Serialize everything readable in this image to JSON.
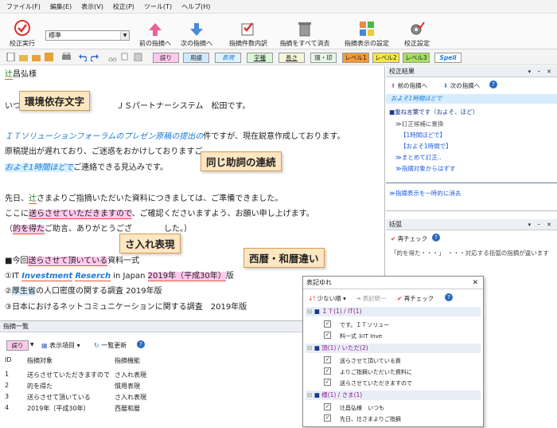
{
  "menu": [
    "ファイル(F)",
    "編集(E)",
    "表示(V)",
    "校正(P)",
    "ツール(T)",
    "ヘルプ(H)"
  ],
  "ribbon": {
    "run": "校正実行",
    "style_value": "標準",
    "prev": "前の指摘へ",
    "next": "次の指摘へ",
    "summary": "指摘件数内訳",
    "clear": "指摘をすべて消去",
    "display_settings": "指摘表示の設定",
    "settings": "校正設定"
  },
  "tags": [
    "誤り",
    "用語",
    "表現",
    "字種",
    "長さ",
    "環・印",
    "レベル1",
    "レベル2",
    "レベル3",
    "Spell"
  ],
  "editor": {
    "l1_a": "辻",
    "l1_b": "昌弘様",
    "l2": "いつ　　　　　　　　　　　　ＪＳパートナーシステム　松田です。",
    "l3_a": "ＩＴソリューションフォーラムのプレゼン原稿の提出の",
    "l3_b": "件ですが、現在鋭意作成しております。",
    "l4": "原稿提出が遅れており、ご迷惑をおかけしておりますご",
    "l5_a": "およそ1時間ほどで",
    "l5_b": "ご連絡できる見込みです。",
    "l6_a": "先日、",
    "l6_b": "辻",
    "l6_c": "さまよりご指摘いただいた資料につきましては、ご準備できました。",
    "l7_a": "ここに",
    "l7_b": "送らさせていただきますので",
    "l7_c": "、ご確認くださいますよう、お願い申し上げます。",
    "l8_a": "（",
    "l8_b": "的を得た",
    "l8_c": "ご助言、ありがとうござ　　　　した。）",
    "l9_a": "■今回",
    "l9_b": "送らさせて頂いている",
    "l9_c": "資料一式",
    "l10_a": "①IT ",
    "l10_b": "Investment",
    "l10_c": "Reserch",
    "l10_d": " in Japan ",
    "l10_e": "2019年（平成30年）",
    "l10_f": "版",
    "l11_a": "②",
    "l11_b": "厚生省",
    "l11_c": "の人口密度の関する調査 2019年版",
    "l12": "③日本におけるネットコミュニケーションに関する調査　2019年版"
  },
  "callouts": {
    "env": "環境依存文字",
    "particle": "同じ助詞の連続",
    "sa": "さ入れ表現",
    "era": "西暦・和暦違い"
  },
  "results_panel": {
    "title": "校正結果",
    "prev": "前の指摘へ",
    "next": "次の指摘へ",
    "selected": "およそ1時間ほどで",
    "head": "■重ね言葉です（およそ、ほど）",
    "items": [
      "≫訂正候補に置換",
      "【1時間ほどで】",
      "【およそ1時間で】",
      "≫まとめて訂正..",
      "≫指摘対象からはずす"
    ],
    "temp_clear": "≫指摘表示を一時的に消去"
  },
  "bracket_panel": {
    "title": "括弧",
    "recheck": "再チェック",
    "item": "「的を得た・・・」　・・・対応する括弧の指摘が違います"
  },
  "list_panel": {
    "title": "指摘一覧",
    "filter": "誤り",
    "display_items": "表示項目",
    "refresh": "一覧更新",
    "columns": [
      "ID",
      "指摘対象",
      "指摘機能"
    ],
    "rows": [
      {
        "id": "1",
        "target": "送らさせていただきますので",
        "func": "さ入れ表現"
      },
      {
        "id": "2",
        "target": "的を得た",
        "func": "慣用表現"
      },
      {
        "id": "3",
        "target": "送らさせて頂いている",
        "func": "さ入れ表現"
      },
      {
        "id": "4",
        "target": "2019年（平成30年）",
        "func": "西暦和暦"
      }
    ]
  },
  "dialog": {
    "title": "表記ゆれ",
    "sort": "少ない順",
    "unify": "表記統一",
    "recheck": "再チェック",
    "groups": [
      {
        "label": "ＩＴ(1) / IT(1)",
        "items": [
          "です。ＩＴソリュー",
          "料一式 ①IT Inve"
        ]
      },
      {
        "label": "頂(1) / いただ(2)",
        "items": [
          "送らさせて頂いている資",
          "よりご指摘いただいた資料に",
          "送らさせていただきますので"
        ]
      },
      {
        "label": "様(1) / さま(1)",
        "items": [
          "辻昌弘様　いつも",
          "先日、辻さまよりご指摘"
        ]
      }
    ]
  },
  "colors": {
    "pink": "#ffc9ec",
    "blue": "#d7efff",
    "accent": "#1e7ad6",
    "callout": "#fde6c2"
  }
}
